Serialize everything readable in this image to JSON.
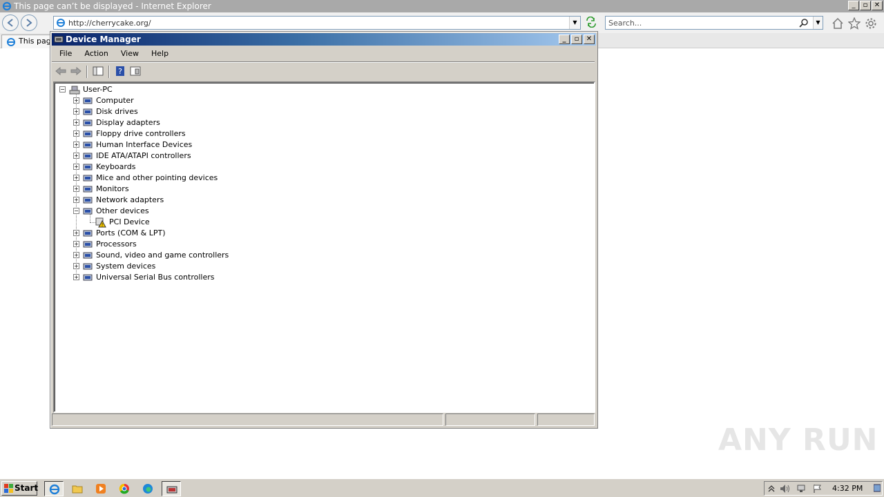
{
  "ie": {
    "title": "This page can’t be displayed - Internet Explorer",
    "url": "http://cherrycake.org/",
    "search_placeholder": "Search...",
    "tab_label": "This page",
    "window_buttons": [
      "_",
      "▫",
      "✕"
    ]
  },
  "device_manager": {
    "title": "Device Manager",
    "menu": [
      "File",
      "Action",
      "View",
      "Help"
    ],
    "root": "User-PC",
    "categories": [
      {
        "label": "Computer",
        "expanded": false
      },
      {
        "label": "Disk drives",
        "expanded": false
      },
      {
        "label": "Display adapters",
        "expanded": false
      },
      {
        "label": "Floppy drive controllers",
        "expanded": false
      },
      {
        "label": "Human Interface Devices",
        "expanded": false
      },
      {
        "label": "IDE ATA/ATAPI controllers",
        "expanded": false
      },
      {
        "label": "Keyboards",
        "expanded": false
      },
      {
        "label": "Mice and other pointing devices",
        "expanded": false
      },
      {
        "label": "Monitors",
        "expanded": false
      },
      {
        "label": "Network adapters",
        "expanded": false
      },
      {
        "label": "Other devices",
        "expanded": true,
        "children": [
          "PCI Device"
        ]
      },
      {
        "label": "Ports (COM & LPT)",
        "expanded": false
      },
      {
        "label": "Processors",
        "expanded": false
      },
      {
        "label": "Sound, video and game controllers",
        "expanded": false
      },
      {
        "label": "System devices",
        "expanded": false
      },
      {
        "label": "Universal Serial Bus controllers",
        "expanded": false
      }
    ]
  },
  "taskbar": {
    "start_label": "Start",
    "clock": "4:32 PM"
  },
  "watermark": "ANY RUN",
  "colors": {
    "title_active_start": "#0a246a",
    "title_active_end": "#a6caf0",
    "chrome": "#d4d0c8"
  }
}
